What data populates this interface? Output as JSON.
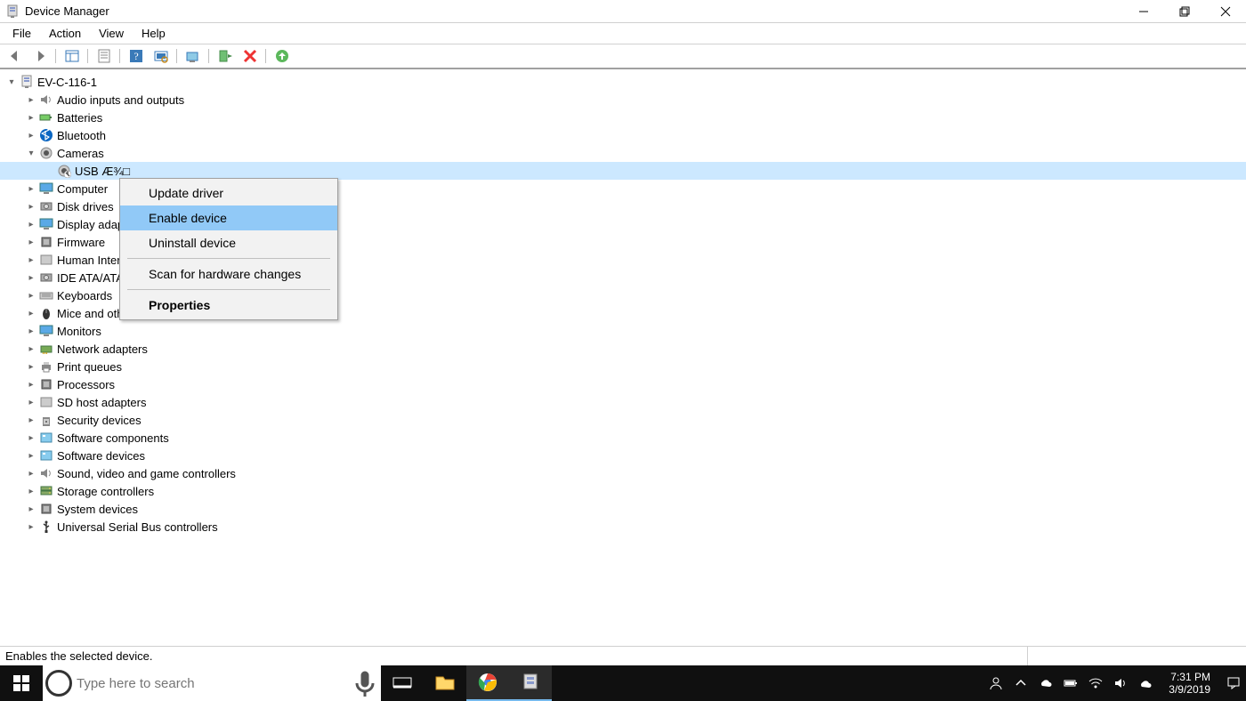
{
  "window": {
    "title": "Device Manager"
  },
  "menu": {
    "file": "File",
    "action": "Action",
    "view": "View",
    "help": "Help"
  },
  "device_tree": {
    "root": "EV-C-116-1",
    "categories": [
      {
        "label": "Audio inputs and outputs"
      },
      {
        "label": "Batteries"
      },
      {
        "label": "Bluetooth"
      },
      {
        "label": "Cameras",
        "expanded": true,
        "children": [
          {
            "label": "USB Æ¾□",
            "selected": true
          }
        ]
      },
      {
        "label": "Computer"
      },
      {
        "label": "Disk drives"
      },
      {
        "label": "Display adapters"
      },
      {
        "label": "Firmware"
      },
      {
        "label": "Human Interface Devices"
      },
      {
        "label": "IDE ATA/ATAPI controllers"
      },
      {
        "label": "Keyboards"
      },
      {
        "label": "Mice and other pointing devices"
      },
      {
        "label": "Monitors"
      },
      {
        "label": "Network adapters"
      },
      {
        "label": "Print queues"
      },
      {
        "label": "Processors"
      },
      {
        "label": "SD host adapters"
      },
      {
        "label": "Security devices"
      },
      {
        "label": "Software components"
      },
      {
        "label": "Software devices"
      },
      {
        "label": "Sound, video and game controllers"
      },
      {
        "label": "Storage controllers"
      },
      {
        "label": "System devices"
      },
      {
        "label": "Universal Serial Bus controllers"
      }
    ]
  },
  "context_menu": {
    "update_driver": "Update driver",
    "enable_device": "Enable device",
    "uninstall_device": "Uninstall device",
    "scan_changes": "Scan for hardware changes",
    "properties": "Properties"
  },
  "statusbar": {
    "text": "Enables the selected device."
  },
  "taskbar": {
    "search_placeholder": "Type here to search",
    "time": "7:31 PM",
    "date": "3/9/2019"
  }
}
